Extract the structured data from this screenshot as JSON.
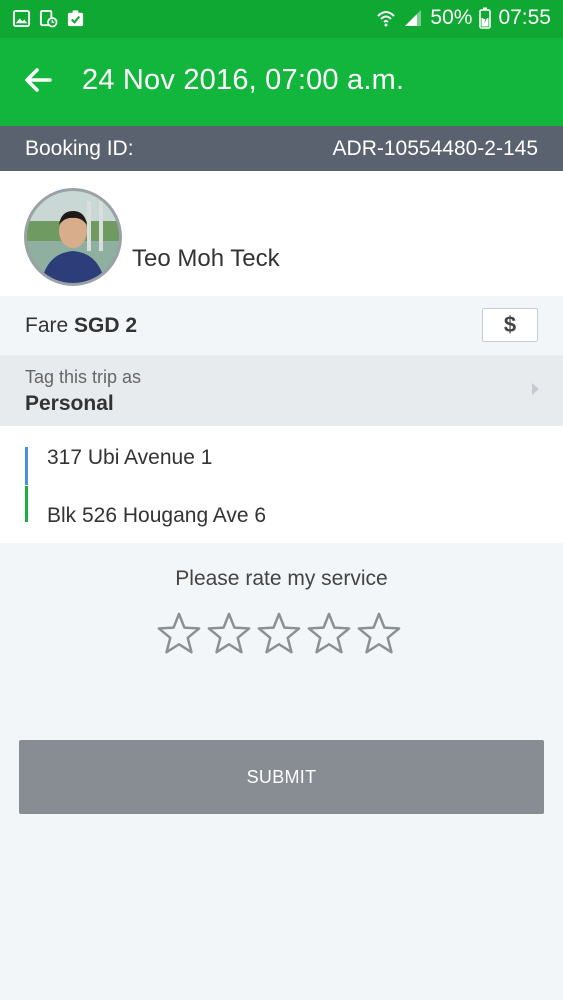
{
  "status_bar": {
    "battery": "50%",
    "time": "07:55"
  },
  "header": {
    "title": "24 Nov 2016, 07:00 a.m."
  },
  "booking": {
    "label": "Booking ID:",
    "id": "ADR-10554480-2-145"
  },
  "driver": {
    "name": "Teo Moh Teck"
  },
  "fare": {
    "label": "Fare",
    "amount": "SGD 2",
    "button_icon": "$"
  },
  "trip_tag": {
    "label": "Tag this trip as",
    "value": "Personal"
  },
  "route": {
    "pickup": "317 Ubi Avenue 1",
    "dropoff": "Blk 526 Hougang Ave 6"
  },
  "rating": {
    "prompt": "Please rate my service",
    "stars": 5,
    "selected": 0
  },
  "submit": {
    "label": "SUBMIT"
  },
  "colors": {
    "status_bar": "#0fa832",
    "app_bar": "#13b63c",
    "booking_bar": "#5a6270",
    "submit_disabled": "#878d92"
  }
}
